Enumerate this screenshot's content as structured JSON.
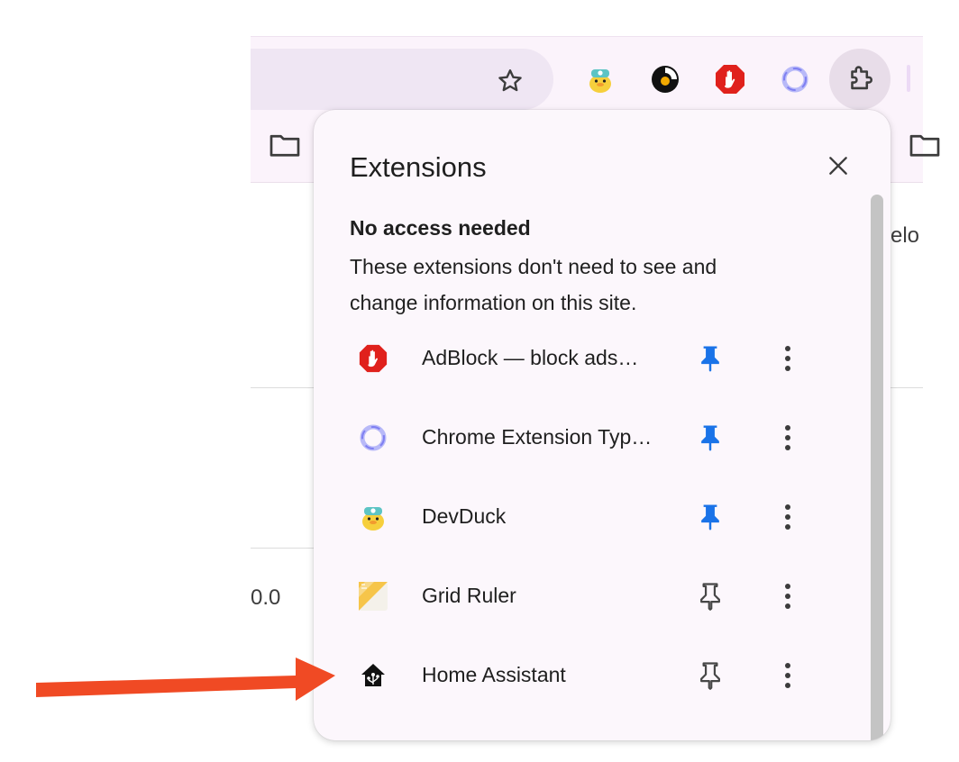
{
  "popup": {
    "title": "Extensions",
    "section_heading": "No access needed",
    "section_description": "These extensions don't need to see and change information on this site.",
    "extensions": [
      {
        "name": "AdBlock — block ads…",
        "icon": "adblock-icon",
        "pinned": true
      },
      {
        "name": "Chrome Extension Typ…",
        "icon": "ring-icon",
        "pinned": true
      },
      {
        "name": "DevDuck",
        "icon": "devduck-icon",
        "pinned": true
      },
      {
        "name": "Grid Ruler",
        "icon": "grid-ruler-icon",
        "pinned": false
      },
      {
        "name": "Home Assistant",
        "icon": "home-assistant-icon",
        "pinned": false
      }
    ]
  },
  "background": {
    "fragment_right": "elo",
    "fragment_left": "0.0"
  },
  "colors": {
    "pin_active": "#1a73e8",
    "pin_inactive": "#474747",
    "arrow": "#f04a24",
    "adblock_red": "#e0211c"
  }
}
